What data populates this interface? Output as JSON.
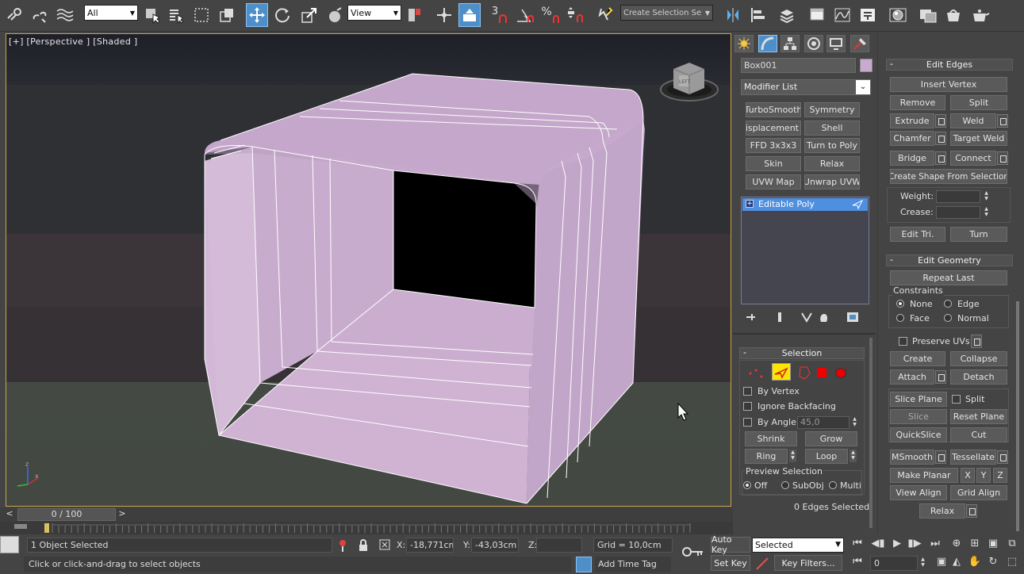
{
  "toolbar": {
    "selection_filter": "All",
    "ref_coord": "View",
    "named_selection_placeholder": "Create Selection Se",
    "snap_3": "3",
    "icons": [
      "link-icon",
      "unlink-icon",
      "bind-space-warp-icon",
      "select-object-icon",
      "select-by-name-icon",
      "rect-region-icon",
      "window-crossing-icon",
      "select-move-icon",
      "select-rotate-icon",
      "select-scale-icon",
      "place-icon",
      "use-pivot-icon",
      "select-manipulate-icon",
      "keyboard-shortcut-icon",
      "snaps-toggle-icon",
      "angle-snap-icon",
      "percent-snap-icon",
      "spinner-snap-icon",
      "edit-named-sets-icon",
      "mirror-icon",
      "align-icon",
      "layer-manager-icon",
      "graphite-ribbon-icon",
      "curve-editor-icon",
      "schematic-view-icon",
      "material-editor-icon",
      "render-setup-icon",
      "rendered-frame-icon",
      "render-icon"
    ]
  },
  "viewport": {
    "label": "[+] [Perspective ] [Shaded ]",
    "viewcube_text": "LEFT"
  },
  "timeline": {
    "frame": "0 / 100",
    "prev": "<",
    "next": ">"
  },
  "command_panel": {
    "tabs": [
      "create-tab",
      "modify-tab",
      "hierarchy-tab",
      "motion-tab",
      "display-tab",
      "utilities-tab"
    ],
    "object_name": "Box001",
    "object_color": "#c9a9cf",
    "modifier_list": "Modifier List",
    "modifier_buttons": [
      "TurboSmooth",
      "Symmetry",
      "yDisplacement",
      "Shell",
      "FFD 3x3x3",
      "Turn to Poly",
      "Skin",
      "Relax",
      "UVW Map",
      "Unwrap UVW"
    ],
    "stack_item": "Editable Poly",
    "stack_expand": "+"
  },
  "selection_rollout": {
    "title": "Selection",
    "by_vertex": "By Vertex",
    "ignore_backfacing": "Ignore Backfacing",
    "by_angle": "By Angle:",
    "angle_value": "45,0",
    "shrink": "Shrink",
    "grow": "Grow",
    "ring": "Ring",
    "loop": "Loop",
    "preview_title": "Preview Selection",
    "preview_off": "Off",
    "preview_subobj": "SubObj",
    "preview_multi": "Multi",
    "status": "0 Edges Selected"
  },
  "edit_edges": {
    "title": "Edit Edges",
    "insert_vertex": "Insert Vertex",
    "remove": "Remove",
    "split": "Split",
    "extrude": "Extrude",
    "weld": "Weld",
    "chamfer": "Chamfer",
    "target_weld": "Target Weld",
    "bridge": "Bridge",
    "connect": "Connect",
    "create_shape": "Create Shape From Selection",
    "weight": "Weight:",
    "crease": "Crease:",
    "edit_tri": "Edit Tri.",
    "turn": "Turn"
  },
  "edit_geometry": {
    "title": "Edit Geometry",
    "repeat_last": "Repeat Last",
    "constraints": "Constraints",
    "c_none": "None",
    "c_edge": "Edge",
    "c_face": "Face",
    "c_normal": "Normal",
    "preserve_uvs": "Preserve UVs",
    "create": "Create",
    "collapse": "Collapse",
    "attach": "Attach",
    "detach": "Detach",
    "slice_plane": "Slice Plane",
    "split": "Split",
    "slice": "Slice",
    "reset_plane": "Reset Plane",
    "quickslice": "QuickSlice",
    "cut": "Cut",
    "msmooth": "MSmooth",
    "tessellate": "Tessellate",
    "make_planar": "Make Planar",
    "x": "X",
    "y": "Y",
    "z": "Z",
    "view_align": "View Align",
    "grid_align": "Grid Align",
    "relax": "Relax"
  },
  "status": {
    "selected_count": "1 Object Selected",
    "prompt": "Click or click-and-drag to select objects",
    "x_label": "X:",
    "x_value": "-18,771cm",
    "y_label": "Y:",
    "y_value": "-43,03cm",
    "z_label": "Z:",
    "z_value": "",
    "grid": "Grid = 10,0cm",
    "auto_key": "Auto Key",
    "set_key": "Set Key",
    "key_mode": "Selected",
    "key_filters": "Key Filters...",
    "add_time_tag": "Add Time Tag",
    "current_frame": "0"
  }
}
